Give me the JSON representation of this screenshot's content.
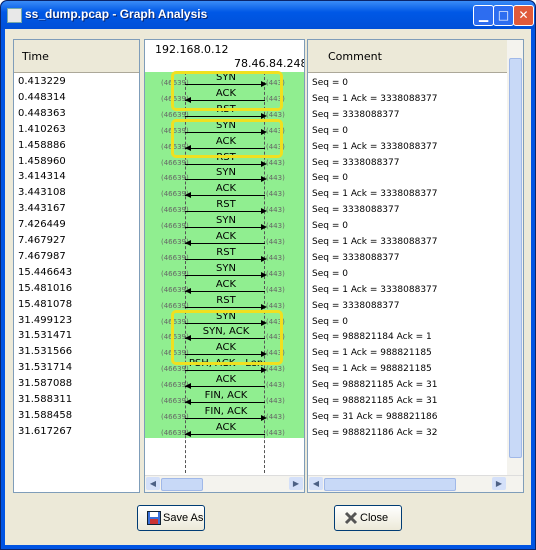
{
  "window": {
    "title": "ss_dump.pcap - Graph Analysis"
  },
  "columns": {
    "time": "Time",
    "comment": "Comment"
  },
  "hosts": {
    "left": "192.168.0.12",
    "right": "78.46.84.248"
  },
  "ports": {
    "left": "(46639)",
    "right": "(443)"
  },
  "times": [
    "0.413229",
    "0.448314",
    "0.448363",
    "1.410263",
    "1.458886",
    "1.458960",
    "3.414314",
    "3.443108",
    "3.443167",
    "7.426449",
    "7.467927",
    "7.467987",
    "15.446643",
    "15.481016",
    "15.481078",
    "31.499123",
    "31.531471",
    "31.531566",
    "31.531714",
    "31.587088",
    "31.588311",
    "31.588458",
    "31.617267"
  ],
  "comments": [
    "Seq = 0",
    "Seq = 1 Ack = 3338088377",
    "Seq = 3338088377",
    "Seq = 0",
    "Seq = 1 Ack = 3338088377",
    "Seq = 3338088377",
    "Seq = 0",
    "Seq = 1 Ack = 3338088377",
    "Seq = 3338088377",
    "Seq = 0",
    "Seq = 1 Ack = 3338088377",
    "Seq = 3338088377",
    "Seq = 0",
    "Seq = 1 Ack = 3338088377",
    "Seq = 3338088377",
    "Seq = 0",
    "Seq = 988821184 Ack = 1",
    "Seq = 1 Ack = 988821185",
    "Seq = 1 Ack = 988821185",
    "Seq = 988821185 Ack = 31",
    "Seq = 988821185 Ack = 31",
    "Seq = 31 Ack = 988821186",
    "Seq = 988821186 Ack = 32"
  ],
  "flows": [
    {
      "label": "SYN",
      "dir": "r"
    },
    {
      "label": "ACK",
      "dir": "l"
    },
    {
      "label": "RST",
      "dir": "r"
    },
    {
      "label": "SYN",
      "dir": "r"
    },
    {
      "label": "ACK",
      "dir": "l"
    },
    {
      "label": "RST",
      "dir": "r"
    },
    {
      "label": "SYN",
      "dir": "r"
    },
    {
      "label": "ACK",
      "dir": "l"
    },
    {
      "label": "RST",
      "dir": "r"
    },
    {
      "label": "SYN",
      "dir": "r"
    },
    {
      "label": "ACK",
      "dir": "l"
    },
    {
      "label": "RST",
      "dir": "r"
    },
    {
      "label": "SYN",
      "dir": "r"
    },
    {
      "label": "ACK",
      "dir": "l"
    },
    {
      "label": "RST",
      "dir": "r"
    },
    {
      "label": "SYN",
      "dir": "r"
    },
    {
      "label": "SYN, ACK",
      "dir": "l"
    },
    {
      "label": "ACK",
      "dir": "r"
    },
    {
      "label": "PSH, ACK - Len",
      "dir": "r"
    },
    {
      "label": "ACK",
      "dir": "l"
    },
    {
      "label": "FIN, ACK",
      "dir": "l"
    },
    {
      "label": "FIN, ACK",
      "dir": "r"
    },
    {
      "label": "ACK",
      "dir": "l"
    }
  ],
  "highlights": [
    {
      "start": 0,
      "count": 2
    },
    {
      "start": 3,
      "count": 2
    },
    {
      "start": 15,
      "count": 3
    }
  ],
  "buttons": {
    "save": "Save As",
    "close": "Close"
  },
  "icons": {
    "save": "floppy-disk-icon",
    "close": "x-icon"
  }
}
